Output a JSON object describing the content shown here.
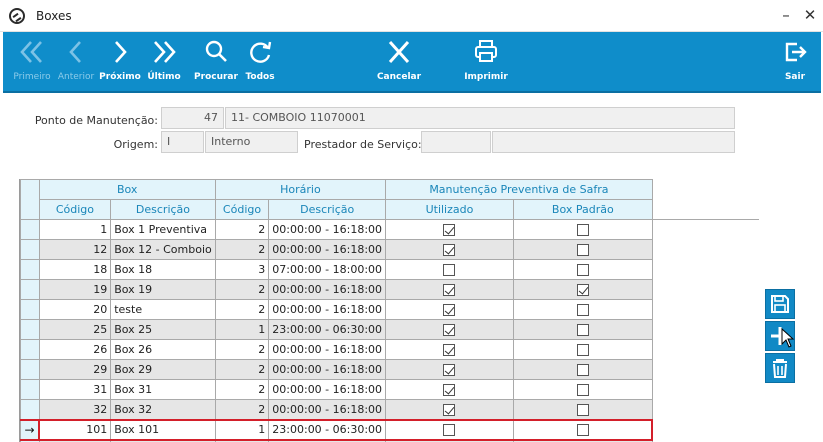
{
  "window": {
    "title": "Boxes",
    "minimize_glyph": "–",
    "close_glyph": "✕"
  },
  "toolbar": {
    "buttons": [
      {
        "label": "Primeiro",
        "icon": "double-chevron-left-icon",
        "enabled": false
      },
      {
        "label": "Anterior",
        "icon": "chevron-left-icon",
        "enabled": false
      },
      {
        "label": "Próximo",
        "icon": "chevron-right-icon",
        "enabled": true
      },
      {
        "label": "Último",
        "icon": "double-chevron-right-icon",
        "enabled": true
      },
      {
        "label": "Procurar",
        "icon": "search-icon",
        "enabled": true
      },
      {
        "label": "Todos",
        "icon": "refresh-icon",
        "enabled": true
      },
      {
        "label": "Cancelar",
        "icon": "close-icon",
        "enabled": true
      },
      {
        "label": "Imprimir",
        "icon": "printer-icon",
        "enabled": true
      },
      {
        "label": "Sair",
        "icon": "exit-icon",
        "enabled": true
      }
    ],
    "accent": "#0f8dca"
  },
  "form": {
    "ponto_label": "Ponto de Manutenção:",
    "ponto_code": "47",
    "ponto_desc": "11- COMBOIO 11070001",
    "origem_label": "Origem:",
    "origem_code": "I",
    "origem_desc": "Interno",
    "prestador_label": "Prestador de Serviço:",
    "prestador_code": "",
    "prestador_desc": ""
  },
  "grid": {
    "groups": {
      "box": "Box",
      "horario": "Horário",
      "manutencao": "Manutenção Preventiva de Safra"
    },
    "columns": {
      "codigo": "Código",
      "descricao": "Descrição",
      "h_codigo": "Código",
      "h_descricao": "Descrição",
      "utilizado": "Utilizado",
      "box_padrao": "Box Padrão"
    },
    "rows": [
      {
        "codigo": "1",
        "descricao": "Box 1 Preventiva",
        "h_codigo": "2",
        "h_descricao": "00:00:00 - 16:18:00",
        "utilizado": true,
        "box_padrao": false
      },
      {
        "codigo": "12",
        "descricao": "Box 12 - Comboio",
        "h_codigo": "2",
        "h_descricao": "00:00:00 - 16:18:00",
        "utilizado": true,
        "box_padrao": false
      },
      {
        "codigo": "18",
        "descricao": "Box 18",
        "h_codigo": "3",
        "h_descricao": "07:00:00 - 18:00:00",
        "utilizado": false,
        "box_padrao": false
      },
      {
        "codigo": "19",
        "descricao": "Box 19",
        "h_codigo": "2",
        "h_descricao": "00:00:00 - 16:18:00",
        "utilizado": true,
        "box_padrao": true
      },
      {
        "codigo": "20",
        "descricao": "teste",
        "h_codigo": "2",
        "h_descricao": "00:00:00 - 16:18:00",
        "utilizado": true,
        "box_padrao": false
      },
      {
        "codigo": "25",
        "descricao": "Box 25",
        "h_codigo": "1",
        "h_descricao": "23:00:00 - 06:30:00",
        "utilizado": true,
        "box_padrao": false
      },
      {
        "codigo": "26",
        "descricao": "Box 26",
        "h_codigo": "2",
        "h_descricao": "00:00:00 - 16:18:00",
        "utilizado": true,
        "box_padrao": false
      },
      {
        "codigo": "29",
        "descricao": "Box 29",
        "h_codigo": "2",
        "h_descricao": "00:00:00 - 16:18:00",
        "utilizado": true,
        "box_padrao": false
      },
      {
        "codigo": "31",
        "descricao": "Box 31",
        "h_codigo": "2",
        "h_descricao": "00:00:00 - 16:18:00",
        "utilizado": true,
        "box_padrao": false
      },
      {
        "codigo": "32",
        "descricao": "Box 32",
        "h_codigo": "2",
        "h_descricao": "00:00:00 - 16:18:00",
        "utilizado": true,
        "box_padrao": false
      },
      {
        "codigo": "101",
        "descricao": "Box 101",
        "h_codigo": "1",
        "h_descricao": "23:00:00 - 06:30:00",
        "utilizado": false,
        "box_padrao": false,
        "selected": true
      }
    ],
    "current_row_marker": "→",
    "highlight_color": "#d31f2a"
  },
  "side_actions": [
    {
      "icon": "save-icon",
      "name": "save-button"
    },
    {
      "icon": "add-icon",
      "name": "add-button"
    },
    {
      "icon": "trash-icon",
      "name": "delete-button"
    }
  ]
}
